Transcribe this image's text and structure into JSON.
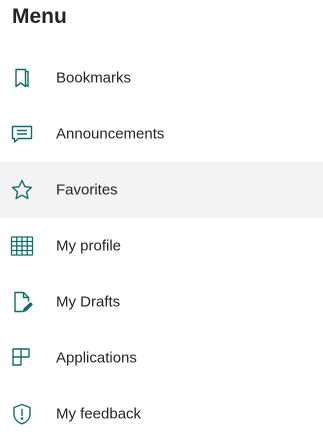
{
  "menu": {
    "title": "Menu",
    "accent_color": "#0f6c6c",
    "active_bg": "#f3f3f3",
    "items": [
      {
        "label": "Bookmarks",
        "icon": "bookmark-icon"
      },
      {
        "label": "Announcements",
        "icon": "announcement-icon"
      },
      {
        "label": "Favorites",
        "icon": "star-icon",
        "active": true
      },
      {
        "label": "My profile",
        "icon": "profile-grid-icon"
      },
      {
        "label": "My Drafts",
        "icon": "draft-edit-icon"
      },
      {
        "label": "Applications",
        "icon": "apps-icon"
      },
      {
        "label": "My feedback",
        "icon": "feedback-shield-icon"
      }
    ]
  }
}
